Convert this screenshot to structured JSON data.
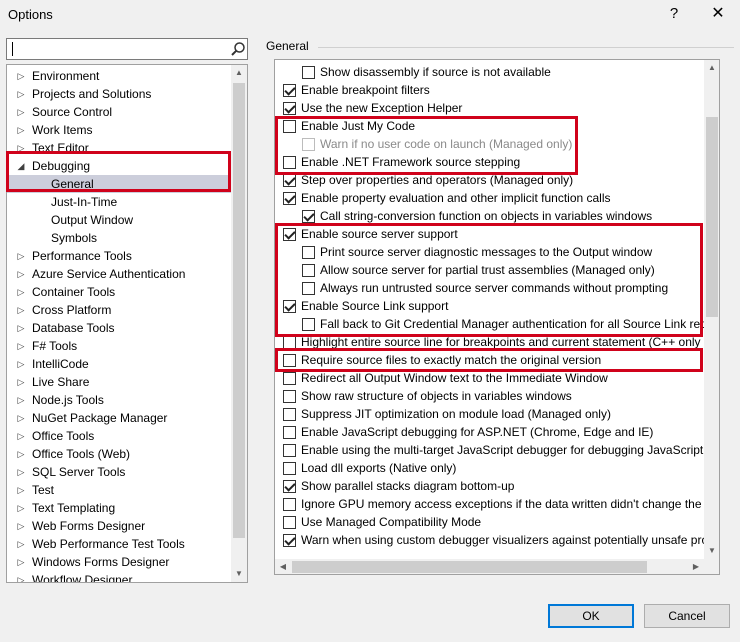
{
  "window": {
    "title": "Options",
    "help_glyph": "?",
    "close_glyph": "✕"
  },
  "search": {
    "value": "",
    "placeholder": ""
  },
  "tree": {
    "items": [
      {
        "label": "Environment",
        "expanded": false,
        "child": false,
        "selected": false
      },
      {
        "label": "Projects and Solutions",
        "expanded": false,
        "child": false,
        "selected": false
      },
      {
        "label": "Source Control",
        "expanded": false,
        "child": false,
        "selected": false
      },
      {
        "label": "Work Items",
        "expanded": false,
        "child": false,
        "selected": false
      },
      {
        "label": "Text Editor",
        "expanded": false,
        "child": false,
        "selected": false
      },
      {
        "label": "Debugging",
        "expanded": true,
        "child": false,
        "selected": false
      },
      {
        "label": "General",
        "expanded": false,
        "child": true,
        "selected": true
      },
      {
        "label": "Just-In-Time",
        "expanded": false,
        "child": true,
        "selected": false
      },
      {
        "label": "Output Window",
        "expanded": false,
        "child": true,
        "selected": false
      },
      {
        "label": "Symbols",
        "expanded": false,
        "child": true,
        "selected": false
      },
      {
        "label": "Performance Tools",
        "expanded": false,
        "child": false,
        "selected": false
      },
      {
        "label": "Azure Service Authentication",
        "expanded": false,
        "child": false,
        "selected": false
      },
      {
        "label": "Container Tools",
        "expanded": false,
        "child": false,
        "selected": false
      },
      {
        "label": "Cross Platform",
        "expanded": false,
        "child": false,
        "selected": false
      },
      {
        "label": "Database Tools",
        "expanded": false,
        "child": false,
        "selected": false
      },
      {
        "label": "F# Tools",
        "expanded": false,
        "child": false,
        "selected": false
      },
      {
        "label": "IntelliCode",
        "expanded": false,
        "child": false,
        "selected": false
      },
      {
        "label": "Live Share",
        "expanded": false,
        "child": false,
        "selected": false
      },
      {
        "label": "Node.js Tools",
        "expanded": false,
        "child": false,
        "selected": false
      },
      {
        "label": "NuGet Package Manager",
        "expanded": false,
        "child": false,
        "selected": false
      },
      {
        "label": "Office Tools",
        "expanded": false,
        "child": false,
        "selected": false
      },
      {
        "label": "Office Tools (Web)",
        "expanded": false,
        "child": false,
        "selected": false
      },
      {
        "label": "SQL Server Tools",
        "expanded": false,
        "child": false,
        "selected": false
      },
      {
        "label": "Test",
        "expanded": false,
        "child": false,
        "selected": false
      },
      {
        "label": "Text Templating",
        "expanded": false,
        "child": false,
        "selected": false
      },
      {
        "label": "Web Forms Designer",
        "expanded": false,
        "child": false,
        "selected": false
      },
      {
        "label": "Web Performance Test Tools",
        "expanded": false,
        "child": false,
        "selected": false
      },
      {
        "label": "Windows Forms Designer",
        "expanded": false,
        "child": false,
        "selected": false
      },
      {
        "label": "Workflow Designer",
        "expanded": false,
        "child": false,
        "selected": false
      }
    ]
  },
  "section": {
    "title": "General"
  },
  "options": [
    {
      "label": "Show disassembly if source is not available",
      "checked": false,
      "indent": 1,
      "disabled": false
    },
    {
      "label": "Enable breakpoint filters",
      "checked": true,
      "indent": 0,
      "disabled": false
    },
    {
      "label": "Use the new Exception Helper",
      "checked": true,
      "indent": 0,
      "disabled": false
    },
    {
      "label": "Enable Just My Code",
      "checked": false,
      "indent": 0,
      "disabled": false
    },
    {
      "label": "Warn if no user code on launch (Managed only)",
      "checked": false,
      "indent": 1,
      "disabled": true
    },
    {
      "label": "Enable .NET Framework source stepping",
      "checked": false,
      "indent": 0,
      "disabled": false
    },
    {
      "label": "Step over properties and operators (Managed only)",
      "checked": true,
      "indent": 0,
      "disabled": false
    },
    {
      "label": "Enable property evaluation and other implicit function calls",
      "checked": true,
      "indent": 0,
      "disabled": false
    },
    {
      "label": "Call string-conversion function on objects in variables windows",
      "checked": true,
      "indent": 1,
      "disabled": false
    },
    {
      "label": "Enable source server support",
      "checked": true,
      "indent": 0,
      "disabled": false
    },
    {
      "label": "Print source server diagnostic messages to the Output window",
      "checked": false,
      "indent": 1,
      "disabled": false
    },
    {
      "label": "Allow source server for partial trust assemblies (Managed only)",
      "checked": false,
      "indent": 1,
      "disabled": false
    },
    {
      "label": "Always run untrusted source server commands without prompting",
      "checked": false,
      "indent": 1,
      "disabled": false
    },
    {
      "label": "Enable Source Link support",
      "checked": true,
      "indent": 0,
      "disabled": false
    },
    {
      "label": "Fall back to Git Credential Manager authentication for all Source Link requ",
      "checked": false,
      "indent": 1,
      "disabled": false
    },
    {
      "label": "Highlight entire source line for breakpoints and current statement (C++ only",
      "checked": false,
      "indent": 0,
      "disabled": false
    },
    {
      "label": "Require source files to exactly match the original version",
      "checked": false,
      "indent": 0,
      "disabled": false
    },
    {
      "label": "Redirect all Output Window text to the Immediate Window",
      "checked": false,
      "indent": 0,
      "disabled": false
    },
    {
      "label": "Show raw structure of objects in variables windows",
      "checked": false,
      "indent": 0,
      "disabled": false
    },
    {
      "label": "Suppress JIT optimization on module load (Managed only)",
      "checked": false,
      "indent": 0,
      "disabled": false
    },
    {
      "label": "Enable JavaScript debugging for ASP.NET (Chrome, Edge and IE)",
      "checked": false,
      "indent": 0,
      "disabled": false
    },
    {
      "label": "Enable using the multi-target JavaScript debugger for debugging JavaScript i",
      "checked": false,
      "indent": 0,
      "disabled": false
    },
    {
      "label": "Load dll exports (Native only)",
      "checked": false,
      "indent": 0,
      "disabled": false
    },
    {
      "label": "Show parallel stacks diagram bottom-up",
      "checked": true,
      "indent": 0,
      "disabled": false
    },
    {
      "label": "Ignore GPU memory access exceptions if the data written didn't change the v",
      "checked": false,
      "indent": 0,
      "disabled": false
    },
    {
      "label": "Use Managed Compatibility Mode",
      "checked": false,
      "indent": 0,
      "disabled": false
    },
    {
      "label": "Warn when using custom debugger visualizers against potentially unsafe pro",
      "checked": true,
      "indent": 0,
      "disabled": false
    }
  ],
  "buttons": {
    "ok": "OK",
    "cancel": "Cancel"
  },
  "colors": {
    "highlight": "#d0021b",
    "selection": "#cccedb",
    "ok_border": "#0078d7"
  }
}
